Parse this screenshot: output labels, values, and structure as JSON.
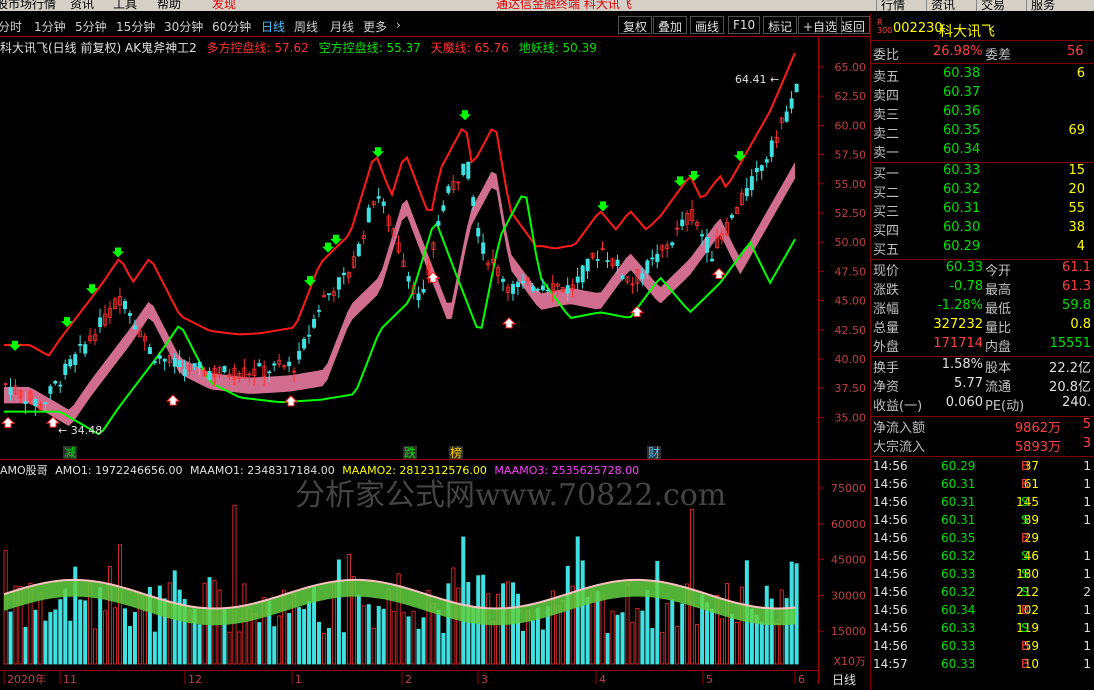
{
  "menu": {
    "items": [
      "股市场行情",
      "资讯",
      "工具",
      "帮助",
      "发现"
    ],
    "center": "通达信金融终端   科大讯飞",
    "right": [
      "行情",
      "资讯",
      "交易",
      "服务"
    ]
  },
  "periods": [
    "分时",
    "1分钟",
    "5分钟",
    "15分钟",
    "30分钟",
    "60分钟",
    "日线",
    "周线",
    "月线",
    "更多"
  ],
  "period_active": "日线",
  "tool_buttons": [
    "复权",
    "叠加",
    "画线",
    "F10",
    "标记",
    "+自选",
    "返回"
  ],
  "chart": {
    "title": "科大讯飞(日线 前复权) AK鬼斧神工2",
    "legend_top": [
      {
        "text": "多方控盘线: 57.62",
        "color": "#ff3030"
      },
      {
        "text": "空方控盘线: 55.37",
        "color": "#00e000"
      },
      {
        "text": "天魔线: 65.76",
        "color": "#ff3030"
      },
      {
        "text": "地妖线: 50.39",
        "color": "#00e000"
      }
    ],
    "price_ticks": [
      "65.00",
      "62.50",
      "60.00",
      "57.50",
      "55.00",
      "52.50",
      "50.00",
      "47.50",
      "45.00",
      "42.50",
      "40.00",
      "37.50",
      "35.00"
    ],
    "high_label": "64.41",
    "low_label": "34.48",
    "tags": [
      {
        "text": "减",
        "color": "#00e000"
      },
      {
        "text": "跌",
        "color": "#00e000"
      },
      {
        "text": "榜",
        "color": "#ffcc00"
      },
      {
        "text": "财",
        "color": "#4ec0ff"
      }
    ],
    "legend_bottom": [
      {
        "text": "AMO股哥",
        "color": "#e0e0e0"
      },
      {
        "text": "AMO1: 1972246656.00",
        "color": "#e0e0e0"
      },
      {
        "text": "MAAMO1: 2348317184.00",
        "color": "#e0e0e0"
      },
      {
        "text": "MAAMO2: 2812312576.00",
        "color": "#ffff00"
      },
      {
        "text": "MAAMO3: 2535625728.00",
        "color": "#ff40ff"
      }
    ],
    "vol_ticks": [
      "75000",
      "60000",
      "45000",
      "30000",
      "15000"
    ],
    "vol_unit": "X10万",
    "x_labels": [
      "2020年",
      "11",
      "12",
      "1",
      "2",
      "3",
      "4",
      "5",
      "6"
    ],
    "footer_tab": "日线",
    "watermark": "分析家公式网www.70822.com"
  },
  "panel": {
    "code": "002230",
    "name": "科大讯飞",
    "badge": "R\n300",
    "wei_bi_label": "委比",
    "wei_bi": "26.98%",
    "wei_cha_label": "委差",
    "wei_cha": "56",
    "asks": [
      {
        "label": "卖五",
        "price": "60.38",
        "vol": "6"
      },
      {
        "label": "卖四",
        "price": "60.37",
        "vol": ""
      },
      {
        "label": "卖三",
        "price": "60.36",
        "vol": ""
      },
      {
        "label": "卖二",
        "price": "60.35",
        "vol": "69"
      },
      {
        "label": "卖一",
        "price": "60.34",
        "vol": ""
      }
    ],
    "bids": [
      {
        "label": "买一",
        "price": "60.33",
        "vol": "15"
      },
      {
        "label": "买二",
        "price": "60.32",
        "vol": "20"
      },
      {
        "label": "买三",
        "price": "60.31",
        "vol": "55"
      },
      {
        "label": "买四",
        "price": "60.30",
        "vol": "38"
      },
      {
        "label": "买五",
        "price": "60.29",
        "vol": "4"
      }
    ],
    "stats": [
      {
        "l1": "现价",
        "v1": "60.33",
        "c1": "grn",
        "l2": "今开",
        "v2": "61.1",
        "c2": "red"
      },
      {
        "l1": "涨跌",
        "v1": "-0.78",
        "c1": "grn",
        "l2": "最高",
        "v2": "61.3",
        "c2": "red"
      },
      {
        "l1": "涨幅",
        "v1": "-1.28%",
        "c1": "grn",
        "l2": "最低",
        "v2": "59.8",
        "c2": "grn"
      },
      {
        "l1": "总量",
        "v1": "327232",
        "c1": "yel",
        "l2": "量比",
        "v2": "0.8",
        "c2": "yel"
      },
      {
        "l1": "外盘",
        "v1": "171714",
        "c1": "red",
        "l2": "内盘",
        "v2": "15551",
        "c2": "grn"
      }
    ],
    "stats2": [
      {
        "l1": "换手",
        "v1": "1.58%",
        "l2": "股本",
        "v2": "22.2亿"
      },
      {
        "l1": "净资",
        "v1": "5.77",
        "l2": "流通",
        "v2": "20.8亿"
      },
      {
        "l1": "收益(一)",
        "v1": "0.060",
        "l2": "PE(动)",
        "v2": "240."
      }
    ],
    "flows": [
      {
        "label": "净流入额",
        "value": "9862万",
        "extra": "5"
      },
      {
        "label": "大宗流入",
        "value": "5893万",
        "extra": "3"
      }
    ],
    "ticks": [
      {
        "t": "14:56",
        "p": "60.29",
        "pc": "grn",
        "v": "37",
        "bs": "B",
        "n": "1"
      },
      {
        "t": "14:56",
        "p": "60.31",
        "pc": "grn",
        "v": "61",
        "bs": "B",
        "n": "1"
      },
      {
        "t": "14:56",
        "p": "60.31",
        "pc": "grn",
        "v": "145",
        "bs": "S",
        "n": "1"
      },
      {
        "t": "14:56",
        "p": "60.31",
        "pc": "grn",
        "v": "89",
        "bs": "S",
        "n": "1"
      },
      {
        "t": "14:56",
        "p": "60.35",
        "pc": "grn",
        "v": "29",
        "bs": "B",
        "n": ""
      },
      {
        "t": "14:56",
        "p": "60.32",
        "pc": "grn",
        "v": "46",
        "bs": "S",
        "n": "1"
      },
      {
        "t": "14:56",
        "p": "60.33",
        "pc": "grn",
        "v": "180",
        "bs": "S",
        "n": "1"
      },
      {
        "t": "14:56",
        "p": "60.32",
        "pc": "grn",
        "v": "212",
        "bs": "S",
        "n": "2"
      },
      {
        "t": "14:56",
        "p": "60.34",
        "pc": "grn",
        "v": "102",
        "bs": "B",
        "n": "1"
      },
      {
        "t": "14:56",
        "p": "60.33",
        "pc": "grn",
        "v": "119",
        "bs": "S",
        "n": "1"
      },
      {
        "t": "14:56",
        "p": "60.33",
        "pc": "grn",
        "v": "59",
        "bs": "B",
        "n": "1"
      },
      {
        "t": "14:57",
        "p": "60.33",
        "pc": "grn",
        "v": "10",
        "bs": "B",
        "n": "1"
      }
    ]
  }
}
